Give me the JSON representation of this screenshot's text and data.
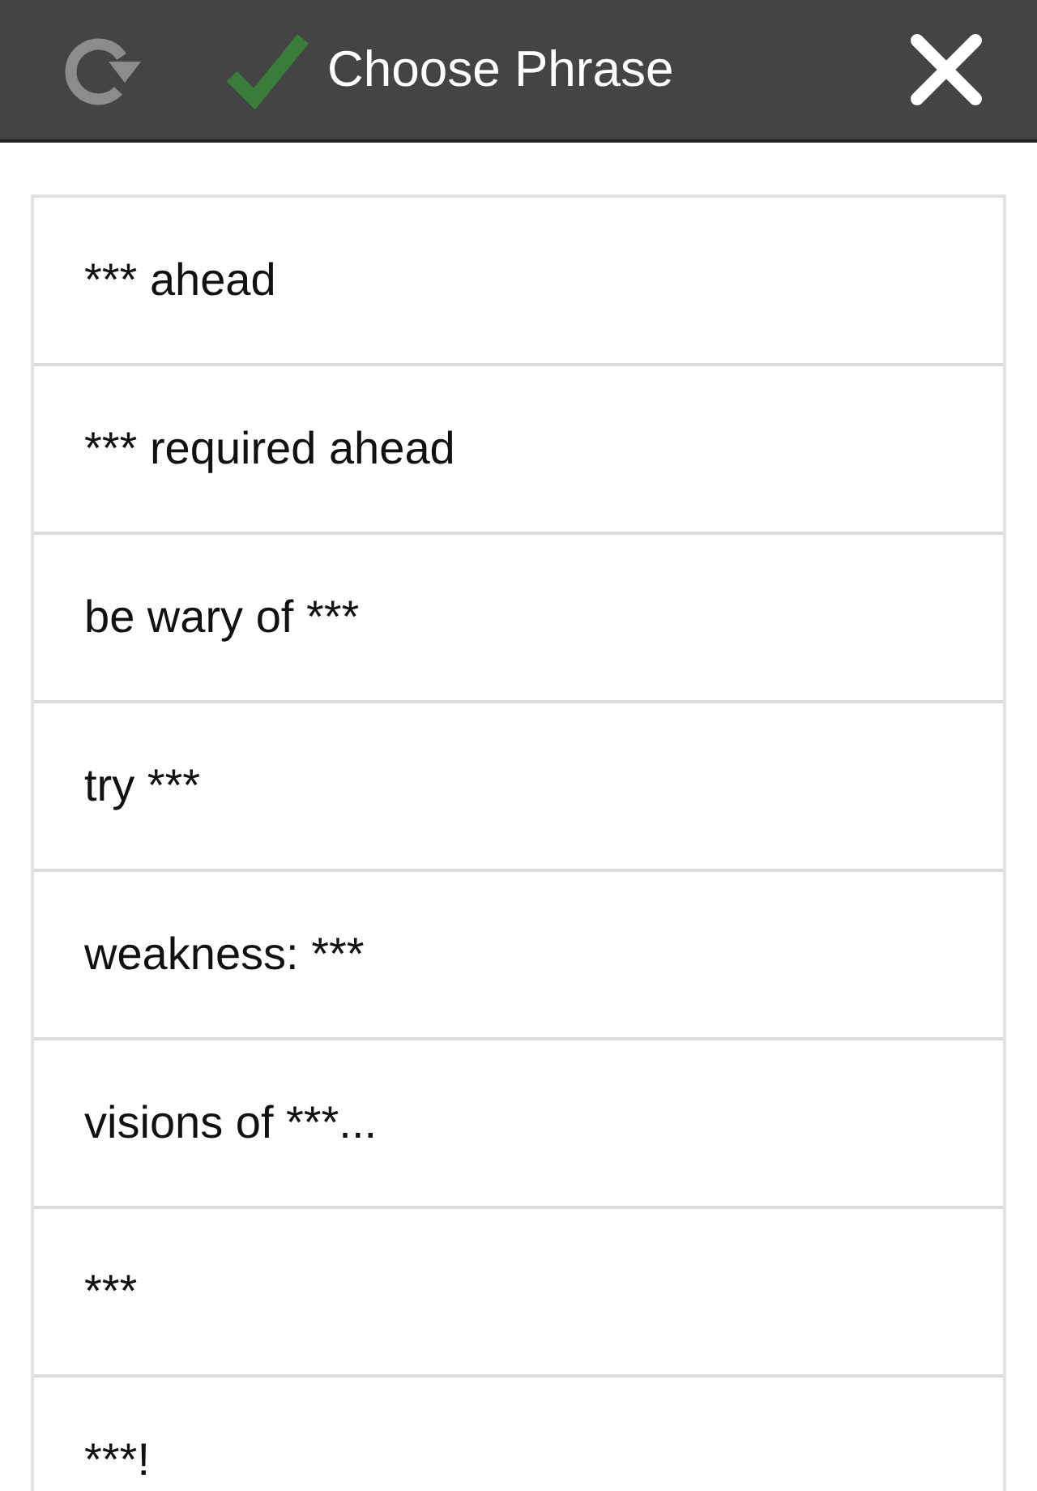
{
  "header": {
    "title": "Choose Phrase"
  },
  "phrases": [
    "*** ahead",
    "*** required ahead",
    "be wary of ***",
    "try ***",
    "weakness: ***",
    "visions of ***...",
    "***",
    "***!"
  ]
}
